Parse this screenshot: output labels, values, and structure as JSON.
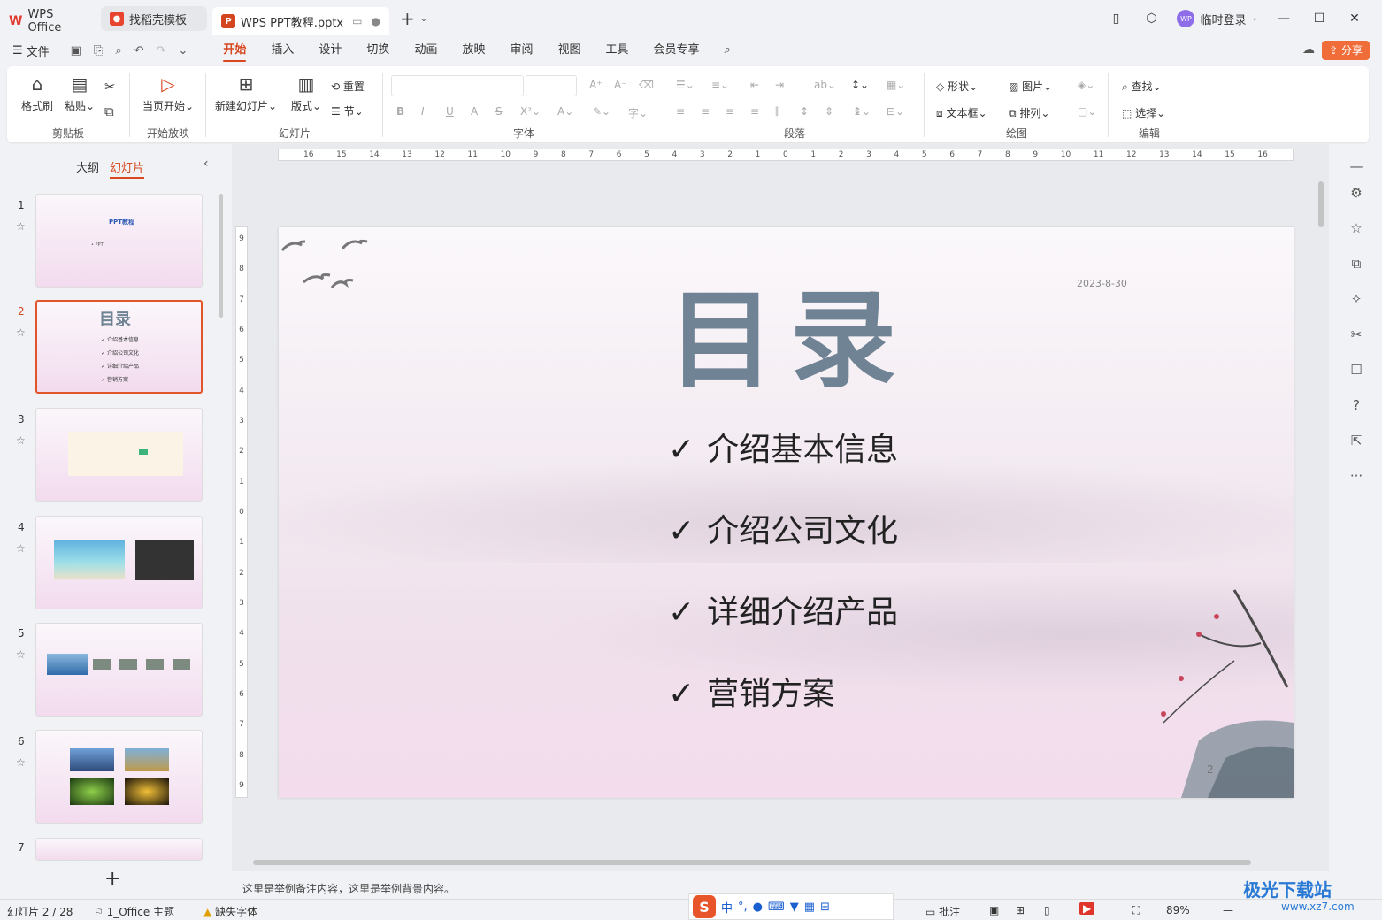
{
  "tabs": {
    "home": "WPS Office",
    "template": "找稻壳模板",
    "active_doc": "WPS PPT教程.pptx"
  },
  "user": {
    "avatar": "WP",
    "login": "临时登录"
  },
  "menu": {
    "file": "文件",
    "tabs": [
      "开始",
      "插入",
      "设计",
      "切换",
      "动画",
      "放映",
      "审阅",
      "视图",
      "工具",
      "会员专享"
    ],
    "share": "分享"
  },
  "ribbon": {
    "clipboard": {
      "label": "剪贴板",
      "format_painter": "格式刷",
      "paste": "粘贴"
    },
    "slideshow": {
      "label": "开始放映",
      "from_current": "当页开始"
    },
    "slides": {
      "label": "幻灯片",
      "new_slide": "新建幻灯片",
      "layout": "版式",
      "reset": "重置",
      "section": "节"
    },
    "font": {
      "label": "字体"
    },
    "paragraph": {
      "label": "段落"
    },
    "drawing": {
      "label": "绘图",
      "shape": "形状",
      "picture": "图片",
      "textbox": "文本框",
      "arrange": "排列"
    },
    "edit": {
      "label": "编辑",
      "find": "查找",
      "select": "选择"
    }
  },
  "left_panel": {
    "outline_tab": "大纲",
    "slides_tab": "幻灯片",
    "slide_numbers": [
      "1",
      "2",
      "3",
      "4",
      "5",
      "6",
      "7"
    ],
    "thumb1_title": "PPT教程",
    "thumb1_sub": "• PPT",
    "thumb2_title": "目录"
  },
  "slide": {
    "title": "目录",
    "date": "2023-8-30",
    "items": [
      "介绍基本信息",
      "介绍公司文化",
      "详细介绍产品",
      "营销方案"
    ],
    "check": "✓",
    "page_number": "2"
  },
  "ruler": {
    "h_ticks": [
      "16",
      "15",
      "14",
      "13",
      "12",
      "11",
      "10",
      "9",
      "8",
      "7",
      "6",
      "5",
      "4",
      "3",
      "2",
      "1",
      "0",
      "1",
      "2",
      "3",
      "4",
      "5",
      "6",
      "7",
      "8",
      "9",
      "10",
      "11",
      "12",
      "13",
      "14",
      "15",
      "16"
    ],
    "v_ticks": [
      "9",
      "8",
      "7",
      "6",
      "5",
      "4",
      "3",
      "2",
      "1",
      "0",
      "1",
      "2",
      "3",
      "4",
      "5",
      "6",
      "7",
      "8",
      "9"
    ]
  },
  "notes": "这里是举例备注内容，这里是举例背景内容。",
  "status": {
    "slide_count": "幻灯片 2 / 28",
    "theme": "1_Office 主题",
    "missing_font": "缺失字体",
    "comment": "批注",
    "zoom": "89%"
  },
  "ime": {
    "lang": "中"
  },
  "watermark": {
    "text": "极光下载站",
    "url": "www.xz7.com"
  }
}
